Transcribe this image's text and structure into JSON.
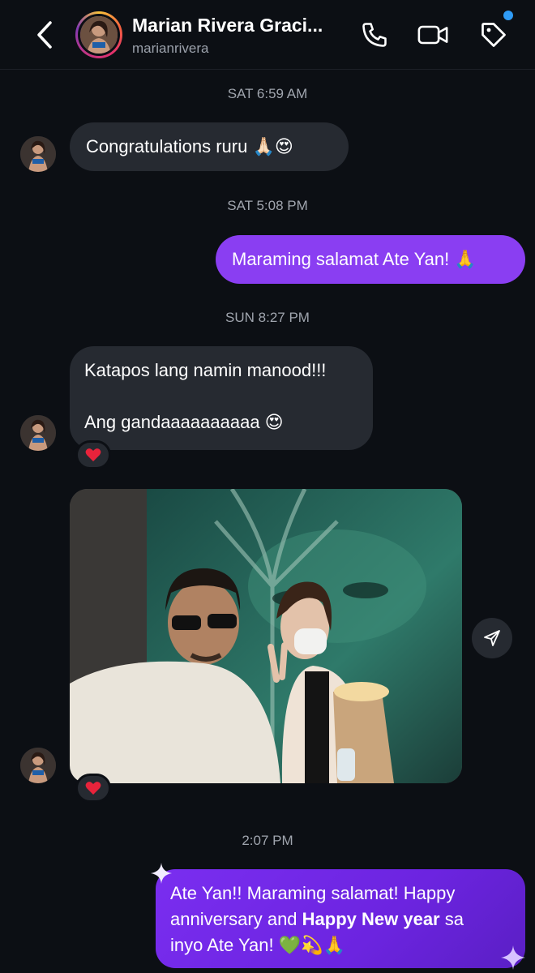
{
  "header": {
    "name": "Marian Rivera Graci...",
    "username": "marianrivera"
  },
  "messages": [
    {
      "timestamp": "SAT 6:59 AM",
      "direction": "incoming",
      "text": "Congratulations ruru 🙏🏻😍"
    },
    {
      "timestamp": "SAT 5:08 PM",
      "direction": "outgoing",
      "text": "Maraming salamat Ate Yan! 🙏"
    },
    {
      "timestamp": "SUN 8:27 PM",
      "direction": "incoming",
      "line1": "Katapos lang namin manood!!!",
      "line2": "Ang gandaaaaaaaaaa 😍",
      "reaction": "❤️"
    },
    {
      "direction": "incoming",
      "type": "photo",
      "reaction": "❤️"
    },
    {
      "timestamp": "2:07 PM",
      "direction": "outgoing",
      "text_a": "Ate Yan!! Maraming salamat! Happy",
      "text_b": "anniversary and ",
      "text_bold": "Happy New year",
      "text_c": " sa",
      "text_d": "inyo Ate Yan! 💚💫🙏"
    }
  ],
  "colors": {
    "background": "#0c0f14",
    "incoming_bubble": "#262a31",
    "outgoing_bubble": "#7c2ff0",
    "notification_dot": "#2f9bf5"
  },
  "icons": [
    "back-chevron-icon",
    "phone-icon",
    "video-camera-icon",
    "tag-icon",
    "send-share-icon",
    "heart-icon"
  ]
}
